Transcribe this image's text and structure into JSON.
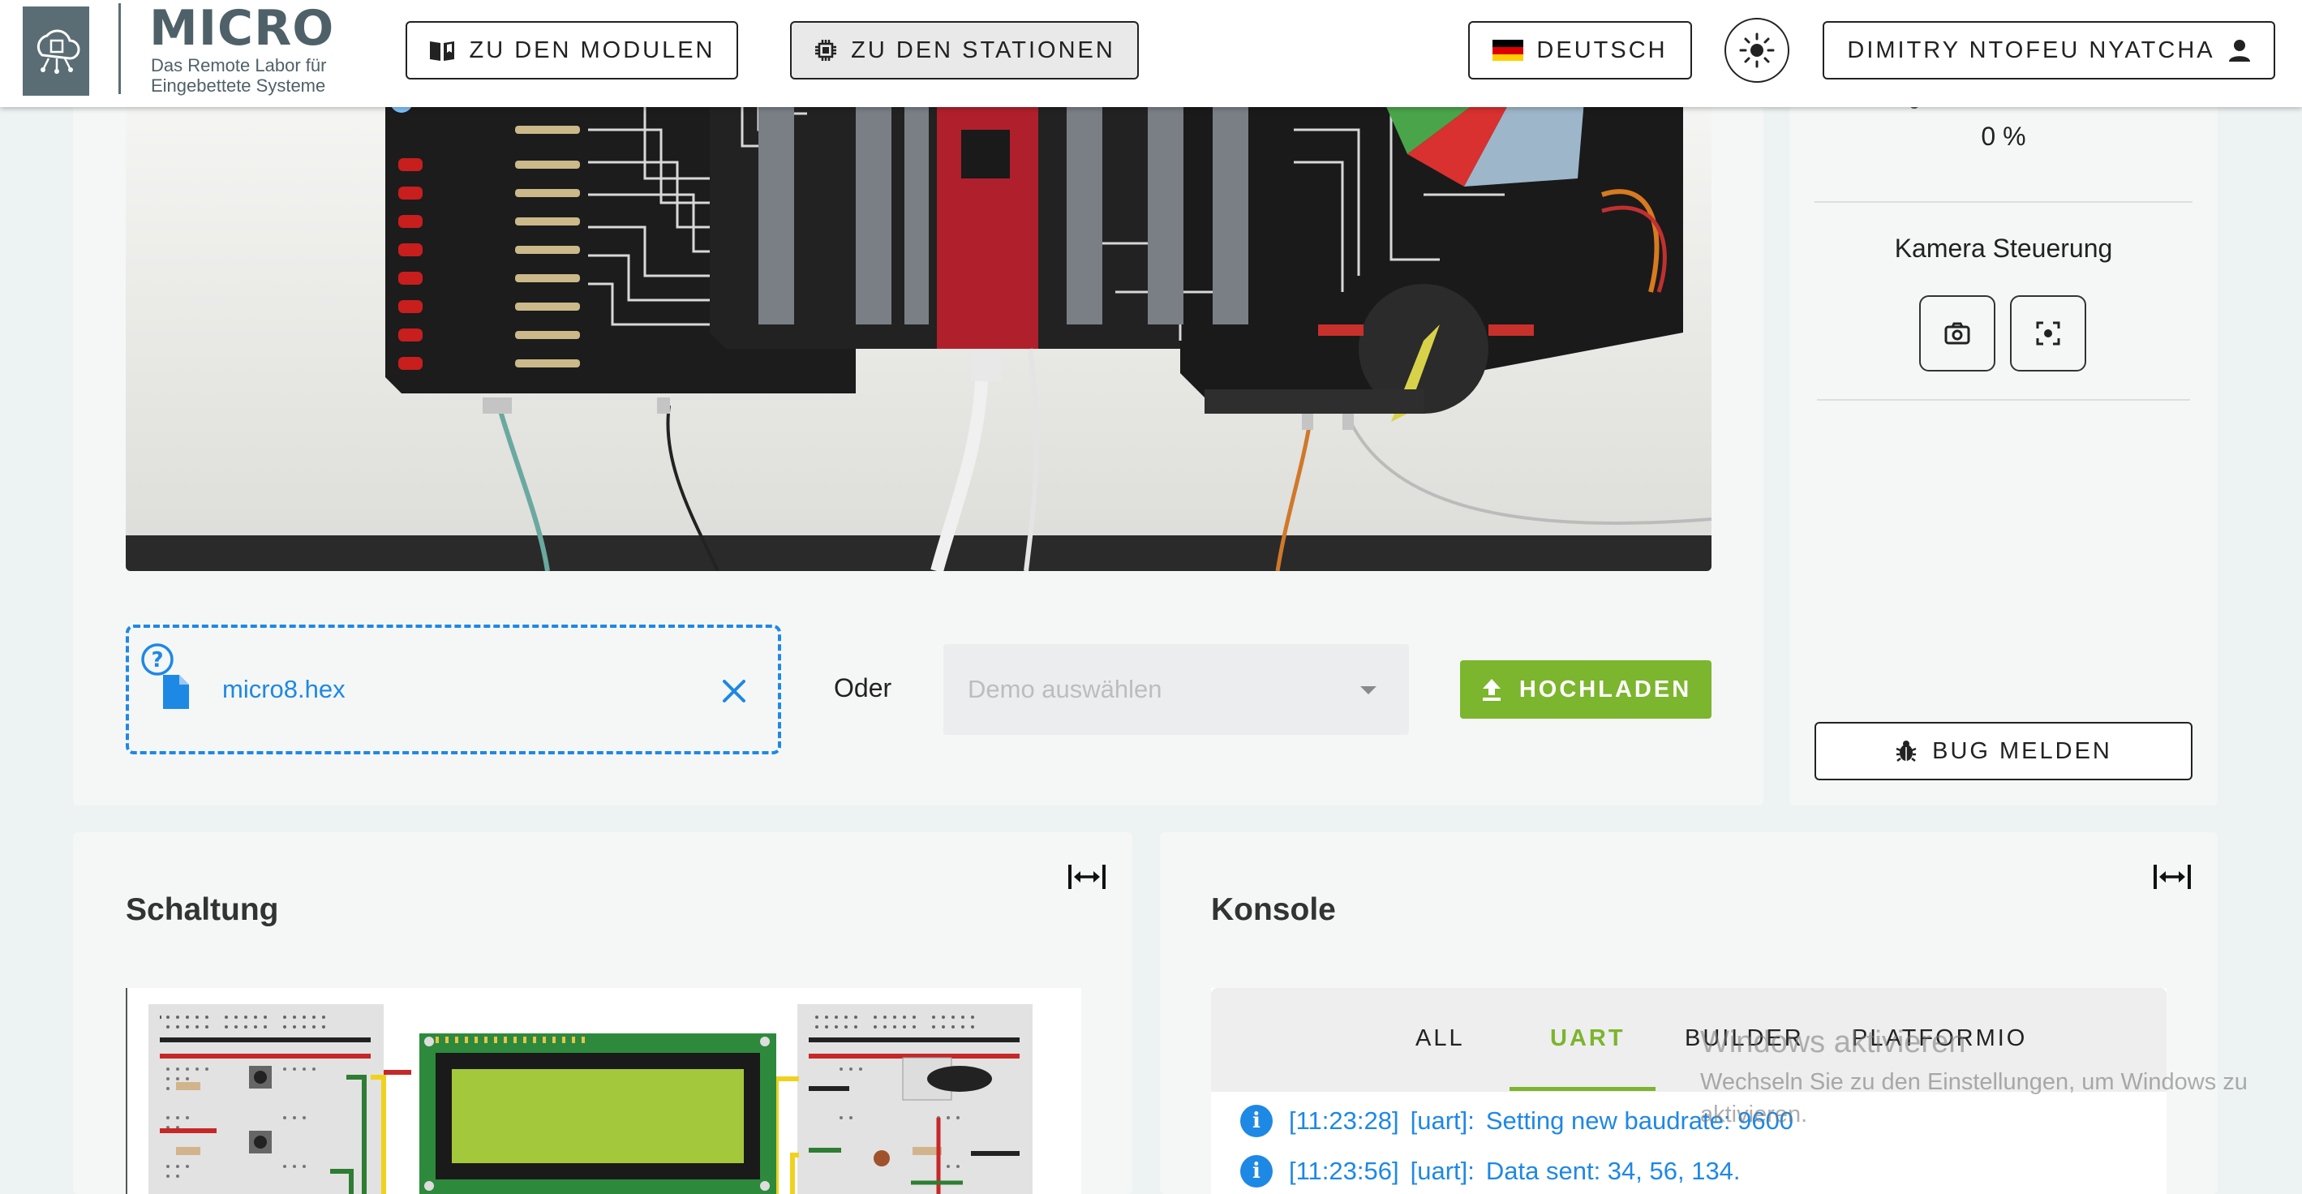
{
  "header": {
    "logo_title": "MICRO",
    "logo_subtitle": "Das Remote Labor für Eingebettete Systeme",
    "modules_label": "ZU DEN MODULEN",
    "stations_label": "ZU DEN STATIONEN",
    "language_label": "DEUTSCH",
    "user_label": "DIMITRY NTOFEU NYATCHA"
  },
  "upload": {
    "file_name": "micro8.hex",
    "or_label": "Oder",
    "demo_placeholder": "Demo auswählen",
    "upload_label": "HOCHLADEN"
  },
  "side": {
    "percent": "0 %",
    "camera_title": "Kamera Steuerung",
    "bug_label": "BUG MELDEN"
  },
  "schaltung": {
    "title": "Schaltung"
  },
  "konsole": {
    "title": "Konsole",
    "tabs": [
      "ALL",
      "UART",
      "BUILDER",
      "PLATFORMIO"
    ],
    "active_tab": "UART",
    "logs": [
      {
        "time": "[11:23:28]",
        "source": "[uart]:",
        "message": "Setting new baudrate: 9600"
      },
      {
        "time": "[11:23:56]",
        "source": "[uart]:",
        "message": "Data sent: 34, 56, 134."
      }
    ]
  },
  "watermark": {
    "title": "Windows aktivieren",
    "subtitle": "Wechseln Sie zu den Einstellungen, um Windows zu aktivieren."
  },
  "colors": {
    "accent_green": "#7cb52e",
    "info_blue": "#1e88e5",
    "logo_slate": "#5a6d74"
  }
}
